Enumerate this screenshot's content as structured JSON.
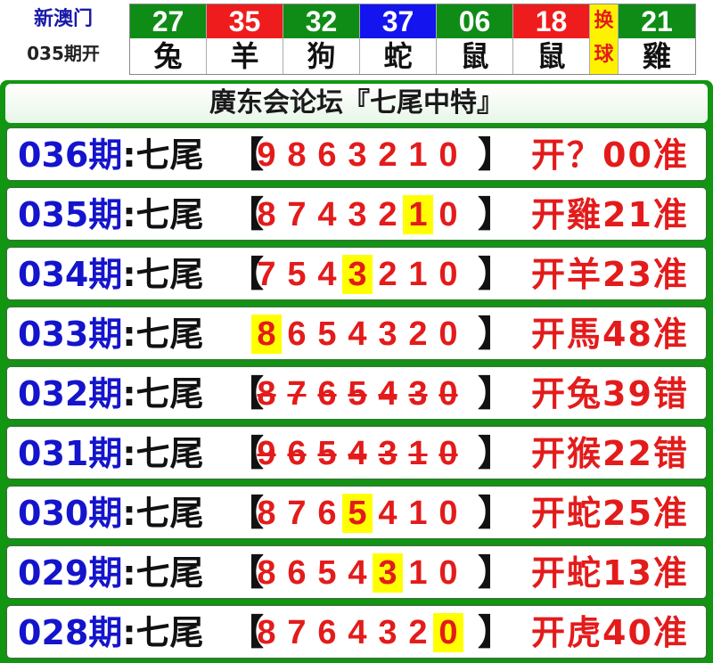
{
  "header": {
    "brand": "新澳门",
    "issue": "035期开",
    "balls": [
      {
        "num": "27",
        "zodiac": "兔",
        "color": "#0f8c16"
      },
      {
        "num": "35",
        "zodiac": "羊",
        "color": "#ee1c1c"
      },
      {
        "num": "32",
        "zodiac": "狗",
        "color": "#0f8c16"
      },
      {
        "num": "37",
        "zodiac": "蛇",
        "color": "#1414ee"
      },
      {
        "num": "06",
        "zodiac": "鼠",
        "color": "#0f8c16"
      },
      {
        "num": "18",
        "zodiac": "鼠",
        "color": "#ee1c1c"
      }
    ],
    "swap_label_1": "换",
    "swap_label_2": "球",
    "special": {
      "num": "21",
      "zodiac": "雞",
      "color": "#0f8c16"
    }
  },
  "forum": {
    "title": "廣东会论坛『七尾中特』",
    "label": ":七尾",
    "bracket_open": "【",
    "bracket_close": "】",
    "rows": [
      {
        "period": "036期",
        "digits": [
          "9",
          "8",
          "6",
          "3",
          "2",
          "1",
          "0"
        ],
        "highlight": -1,
        "strike": false,
        "result": "开？00准"
      },
      {
        "period": "035期",
        "digits": [
          "8",
          "7",
          "4",
          "3",
          "2",
          "1",
          "0"
        ],
        "highlight": 5,
        "strike": false,
        "result": "开雞21准"
      },
      {
        "period": "034期",
        "digits": [
          "7",
          "5",
          "4",
          "3",
          "2",
          "1",
          "0"
        ],
        "highlight": 3,
        "strike": false,
        "result": "开羊23准"
      },
      {
        "period": "033期",
        "digits": [
          "8",
          "6",
          "5",
          "4",
          "3",
          "2",
          "0"
        ],
        "highlight": 0,
        "strike": false,
        "result": "开馬48准"
      },
      {
        "period": "032期",
        "digits": [
          "8",
          "7",
          "6",
          "5",
          "4",
          "3",
          "0"
        ],
        "highlight": -1,
        "strike": true,
        "result": "开兔39错"
      },
      {
        "period": "031期",
        "digits": [
          "9",
          "6",
          "5",
          "4",
          "3",
          "1",
          "0"
        ],
        "highlight": -1,
        "strike": true,
        "result": "开猴22错"
      },
      {
        "period": "030期",
        "digits": [
          "8",
          "7",
          "6",
          "5",
          "4",
          "1",
          "0"
        ],
        "highlight": 3,
        "strike": false,
        "result": "开蛇25准"
      },
      {
        "period": "029期",
        "digits": [
          "8",
          "6",
          "5",
          "4",
          "3",
          "1",
          "0"
        ],
        "highlight": 4,
        "strike": false,
        "result": "开蛇13准"
      },
      {
        "period": "028期",
        "digits": [
          "8",
          "7",
          "6",
          "4",
          "3",
          "2",
          "0"
        ],
        "highlight": 6,
        "strike": false,
        "result": "开虎40准"
      }
    ]
  }
}
